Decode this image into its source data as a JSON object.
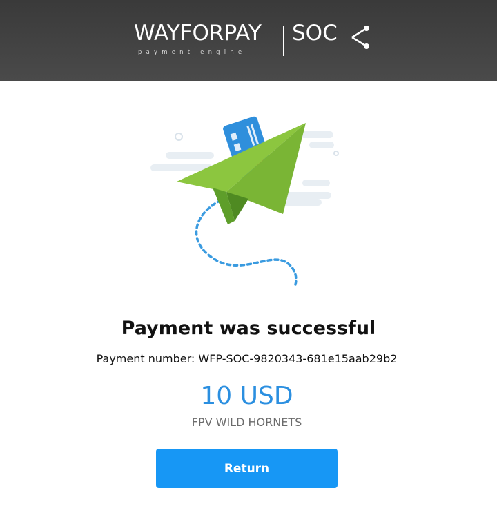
{
  "header": {
    "brand": "WAYFORPAY",
    "tagline": "payment engine",
    "partner": "SOC",
    "share_icon": "share-icon"
  },
  "illustration": {
    "icon": "paper-plane-card-icon",
    "colors": {
      "plane_light": "#8cc63f",
      "plane_dark": "#5e9e2a",
      "card": "#2f8fdc",
      "accent_dot": "#e8533d",
      "trail": "#3a9be0"
    }
  },
  "result": {
    "title": "Payment was successful",
    "number_label": "Payment number:",
    "number_value": "WFP-SOC-9820343-681e15aab29b2",
    "amount": "10 USD",
    "merchant": "FPV WILD HORNETS"
  },
  "actions": {
    "return_label": "Return"
  },
  "colors": {
    "header_bg": "#444444",
    "amount": "#2b8fe0",
    "button": "#1797f5"
  }
}
